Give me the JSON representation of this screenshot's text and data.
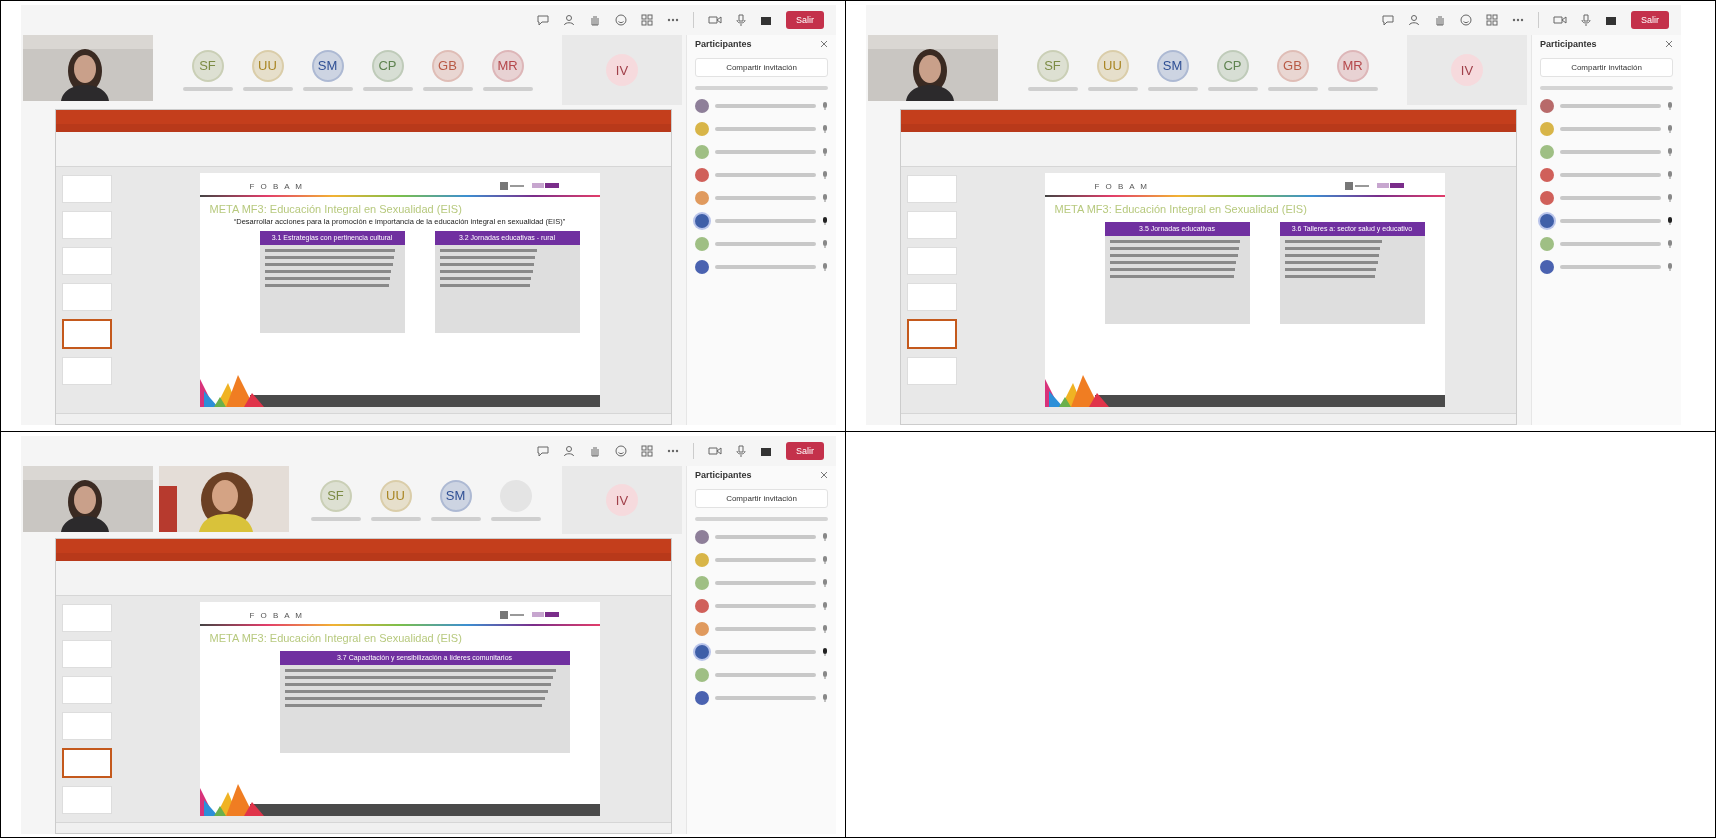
{
  "panels": [
    {
      "leave_label": "Salir",
      "avatars": [
        {
          "kind": "initials",
          "initials": "SF",
          "color": "#7d8c45"
        },
        {
          "kind": "initials",
          "initials": "UU",
          "color": "#a98624"
        },
        {
          "kind": "initials",
          "initials": "SM",
          "color": "#2f4f94"
        },
        {
          "kind": "initials",
          "initials": "CP",
          "color": "#5f8350"
        },
        {
          "kind": "initials",
          "initials": "GB",
          "color": "#b85a45"
        },
        {
          "kind": "initials",
          "initials": "MR",
          "color": "#b4474a"
        }
      ],
      "spotlight": {
        "initials": "IV"
      },
      "thumbnails": [
        {
          "selected": false
        },
        {
          "selected": false
        },
        {
          "selected": false
        },
        {
          "selected": false
        },
        {
          "selected": true
        },
        {
          "selected": false
        }
      ],
      "slide": {
        "brand": "F O B A M",
        "title": "META MF3: Educación Integral en Sexualidad (EIS)",
        "subtitle": "“Desarrollar acciones para la promoción e importancia de la educación integral en sexualidad (EIS)”",
        "boxes": [
          {
            "heading": "3.1 Estrategias con pertinencia cultural"
          },
          {
            "heading": "3.2 Jornadas educativas - rural"
          }
        ]
      },
      "participants": {
        "title": "Participantes",
        "invite": "Compartir invitación",
        "people": [
          {
            "color": "#8e7f99",
            "speaking": false
          },
          {
            "color": "#d8b548",
            "speaking": false
          },
          {
            "color": "#9fbf84",
            "speaking": false
          },
          {
            "color": "#d0605a",
            "speaking": false
          },
          {
            "color": "#e09a5e",
            "speaking": false
          },
          {
            "color": "#3f5fa8",
            "speaking": true
          },
          {
            "color": "#9fbf84",
            "speaking": false
          },
          {
            "color": "#4a62b0",
            "speaking": false
          }
        ]
      }
    },
    {
      "leave_label": "Salir",
      "avatars": [
        {
          "kind": "initials",
          "initials": "SF",
          "color": "#7d8c45"
        },
        {
          "kind": "initials",
          "initials": "UU",
          "color": "#a98624"
        },
        {
          "kind": "initials",
          "initials": "SM",
          "color": "#2f4f94"
        },
        {
          "kind": "initials",
          "initials": "CP",
          "color": "#5f8350"
        },
        {
          "kind": "initials",
          "initials": "GB",
          "color": "#b85a45"
        },
        {
          "kind": "initials",
          "initials": "MR",
          "color": "#b4474a"
        }
      ],
      "spotlight": {
        "initials": "IV"
      },
      "thumbnails": [
        {
          "selected": false
        },
        {
          "selected": false
        },
        {
          "selected": false
        },
        {
          "selected": false
        },
        {
          "selected": true
        },
        {
          "selected": false
        }
      ],
      "slide": {
        "brand": "F O B A M",
        "title": "META MF3: Educación Integral en Sexualidad (EIS)",
        "boxes": [
          {
            "heading": "3.5 Jornadas educativas"
          },
          {
            "heading": "3.6 Talleres a: sector salud y educativo"
          }
        ]
      },
      "participants": {
        "title": "Participantes",
        "invite": "Compartir invitación",
        "people": [
          {
            "color": "#b86a6a",
            "speaking": false
          },
          {
            "color": "#d8b548",
            "speaking": false
          },
          {
            "color": "#9fbf84",
            "speaking": false
          },
          {
            "color": "#d0605a",
            "speaking": false
          },
          {
            "color": "#d0605a",
            "speaking": false
          },
          {
            "color": "#3f5fa8",
            "speaking": true
          },
          {
            "color": "#9fbf84",
            "speaking": false
          },
          {
            "color": "#4a62b0",
            "speaking": false
          }
        ]
      }
    },
    {
      "leave_label": "Salir",
      "avatars": [
        {
          "kind": "initials",
          "initials": "SF",
          "color": "#7d8c45"
        },
        {
          "kind": "initials",
          "initials": "UU",
          "color": "#a98624"
        },
        {
          "kind": "initials",
          "initials": "SM",
          "color": "#2f4f94"
        },
        {
          "kind": "blank",
          "color": "#e4e4e4"
        }
      ],
      "spotlight": {
        "initials": "IV"
      },
      "thumbnails": [
        {
          "selected": false
        },
        {
          "selected": false
        },
        {
          "selected": false
        },
        {
          "selected": false
        },
        {
          "selected": true
        },
        {
          "selected": false
        }
      ],
      "slide": {
        "brand": "F O B A M",
        "title": "META MF3: Educación Integral en Sexualidad (EIS)",
        "boxes": [
          {
            "heading": "3.7 Capacitación y sensibilización a líderes comunitarios"
          }
        ]
      },
      "participants": {
        "title": "Participantes",
        "invite": "Compartir invitación",
        "people": [
          {
            "color": "#8e7f99",
            "speaking": false
          },
          {
            "color": "#d8b548",
            "speaking": false
          },
          {
            "color": "#9fbf84",
            "speaking": false
          },
          {
            "color": "#d0605a",
            "speaking": false
          },
          {
            "color": "#e09a5e",
            "speaking": false
          },
          {
            "color": "#3f5fa8",
            "speaking": true
          },
          {
            "color": "#9fbf84",
            "speaking": false
          },
          {
            "color": "#4a62b0",
            "speaking": false
          }
        ]
      }
    }
  ]
}
